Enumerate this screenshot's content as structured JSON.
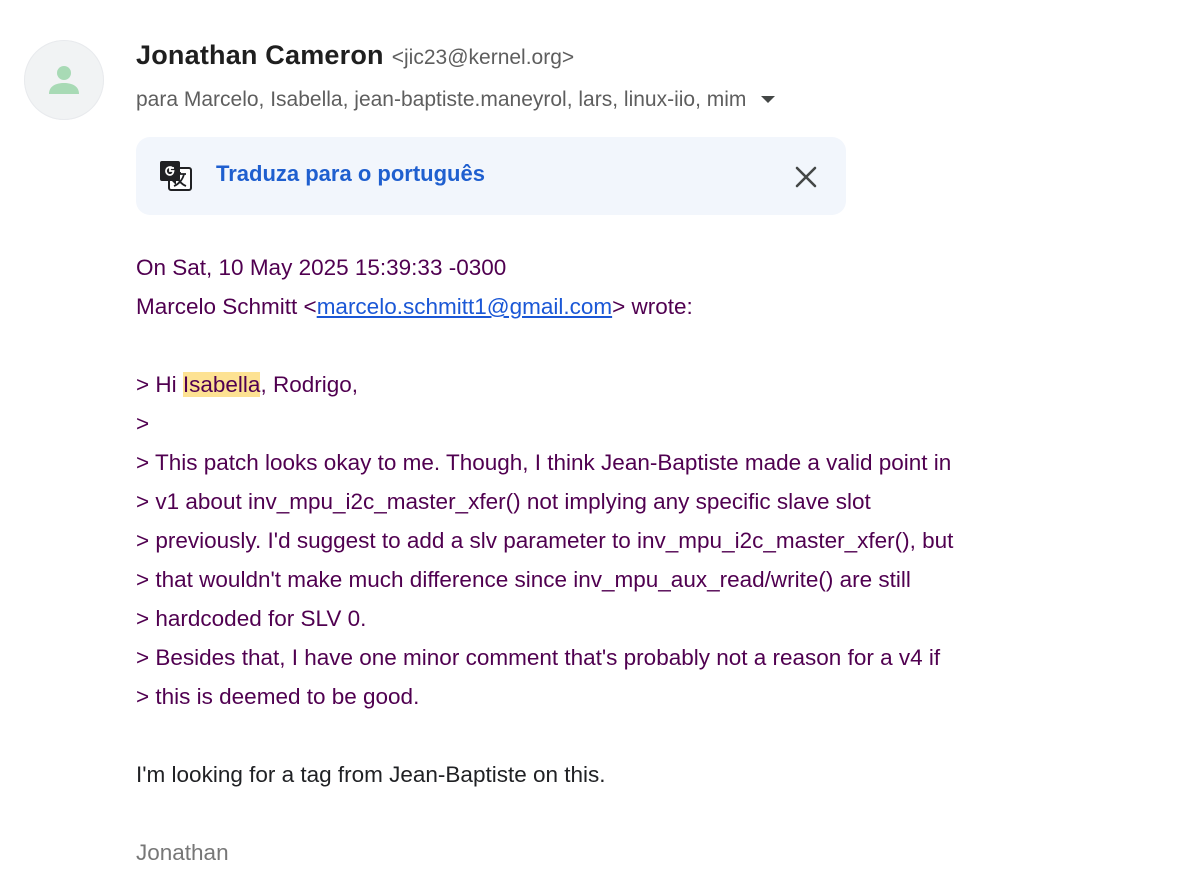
{
  "sender": {
    "name": "Jonathan Cameron",
    "email": "<jic23@kernel.org>",
    "recipients": "para Marcelo, Isabella, jean-baptiste.maneyrol, lars, linux-iio, mim"
  },
  "translate_bar": {
    "link_label": "Traduza para o português"
  },
  "icons": {
    "avatar": "person-icon",
    "dropdown": "caret-down-icon",
    "translate": "google-translate-icon",
    "close": "close-icon"
  },
  "colors": {
    "quoted_text": "#500050",
    "link": "#1a57d6",
    "translate_link": "#1f5fcf",
    "highlight": "#fde293",
    "translate_bar_bg": "#f2f6fc",
    "avatar_fg": "#a8dab5"
  },
  "message": {
    "quote_header_line1": "On Sat, 10 May 2025 15:39:33 -0300",
    "quote_header_name": "Marcelo Schmitt <",
    "quote_header_email": "marcelo.schmitt1@gmail.com",
    "quote_header_suffix": "> wrote:",
    "quote_line1_prefix": "> Hi ",
    "quote_line1_highlight": "Isabella",
    "quote_line1_suffix": ", Rodrigo,",
    "quote_line2": ">",
    "quote_line3": "> This patch looks okay to me. Though, I think Jean-Baptiste made a valid point in",
    "quote_line4": "> v1 about inv_mpu_i2c_master_xfer() not implying any specific slave slot",
    "quote_line5": "> previously. I'd suggest to add a slv parameter to inv_mpu_i2c_master_xfer(), but",
    "quote_line6": "> that wouldn't make much difference since inv_mpu_aux_read/write() are still",
    "quote_line7": "> hardcoded for SLV 0.",
    "quote_line8": "> Besides that, I have one minor comment that's probably not a reason for a v4 if",
    "quote_line9": "> this is deemed to be good.",
    "reply_text": "I'm looking for a tag from Jean-Baptiste on this.",
    "signature": "Jonathan"
  }
}
